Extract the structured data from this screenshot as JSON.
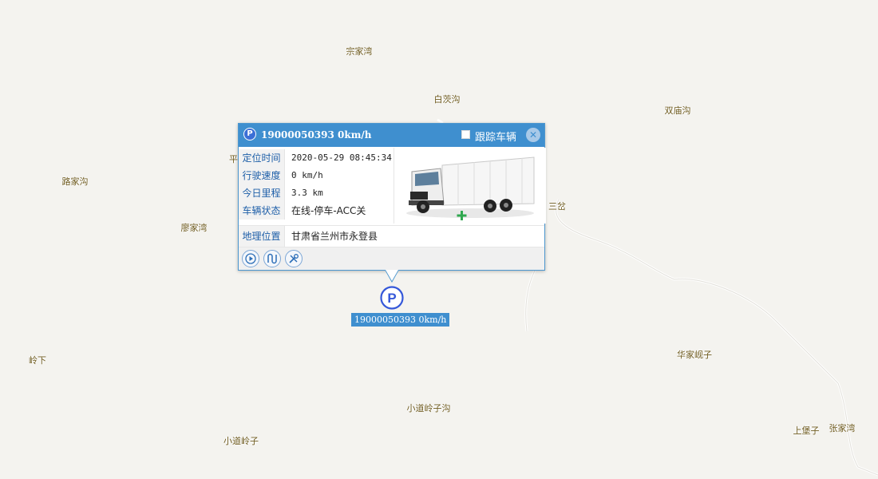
{
  "places": [
    {
      "name": "宗家湾"
    },
    {
      "name": "白茨沟"
    },
    {
      "name": "双庙沟"
    },
    {
      "name": "平咀"
    },
    {
      "name": "路家沟"
    },
    {
      "name": "廖家湾"
    },
    {
      "name": "三岔"
    },
    {
      "name": "岭下"
    },
    {
      "name": "华家岘子"
    },
    {
      "name": "小道岭子沟"
    },
    {
      "name": "小道岭子"
    },
    {
      "name": "上堡子"
    },
    {
      "name": "张家湾"
    }
  ],
  "popup": {
    "title": "19000050393 0km/h",
    "track_label": "跟踪车辆",
    "track_checked": false,
    "close_icon": "close-icon",
    "rows": [
      {
        "label": "定位时间",
        "value": "2020-05-29 08:45:34"
      },
      {
        "label": "行驶速度",
        "value": "0 km/h"
      },
      {
        "label": "今日里程",
        "value": "3.3 km"
      },
      {
        "label": "车辆状态",
        "value": "在线-停车-ACC关"
      }
    ],
    "location": {
      "label": "地理位置",
      "value": "甘肃省兰州市永登县"
    },
    "tools": [
      "play-icon",
      "track-path-icon",
      "tools-icon"
    ]
  },
  "marker": {
    "label": "19000050393 0km/h",
    "icon": "parking-icon"
  },
  "colors": {
    "accent": "#3f8fcf",
    "place_text": "#6e5a1e",
    "map_bg": "#f4f3ef"
  }
}
